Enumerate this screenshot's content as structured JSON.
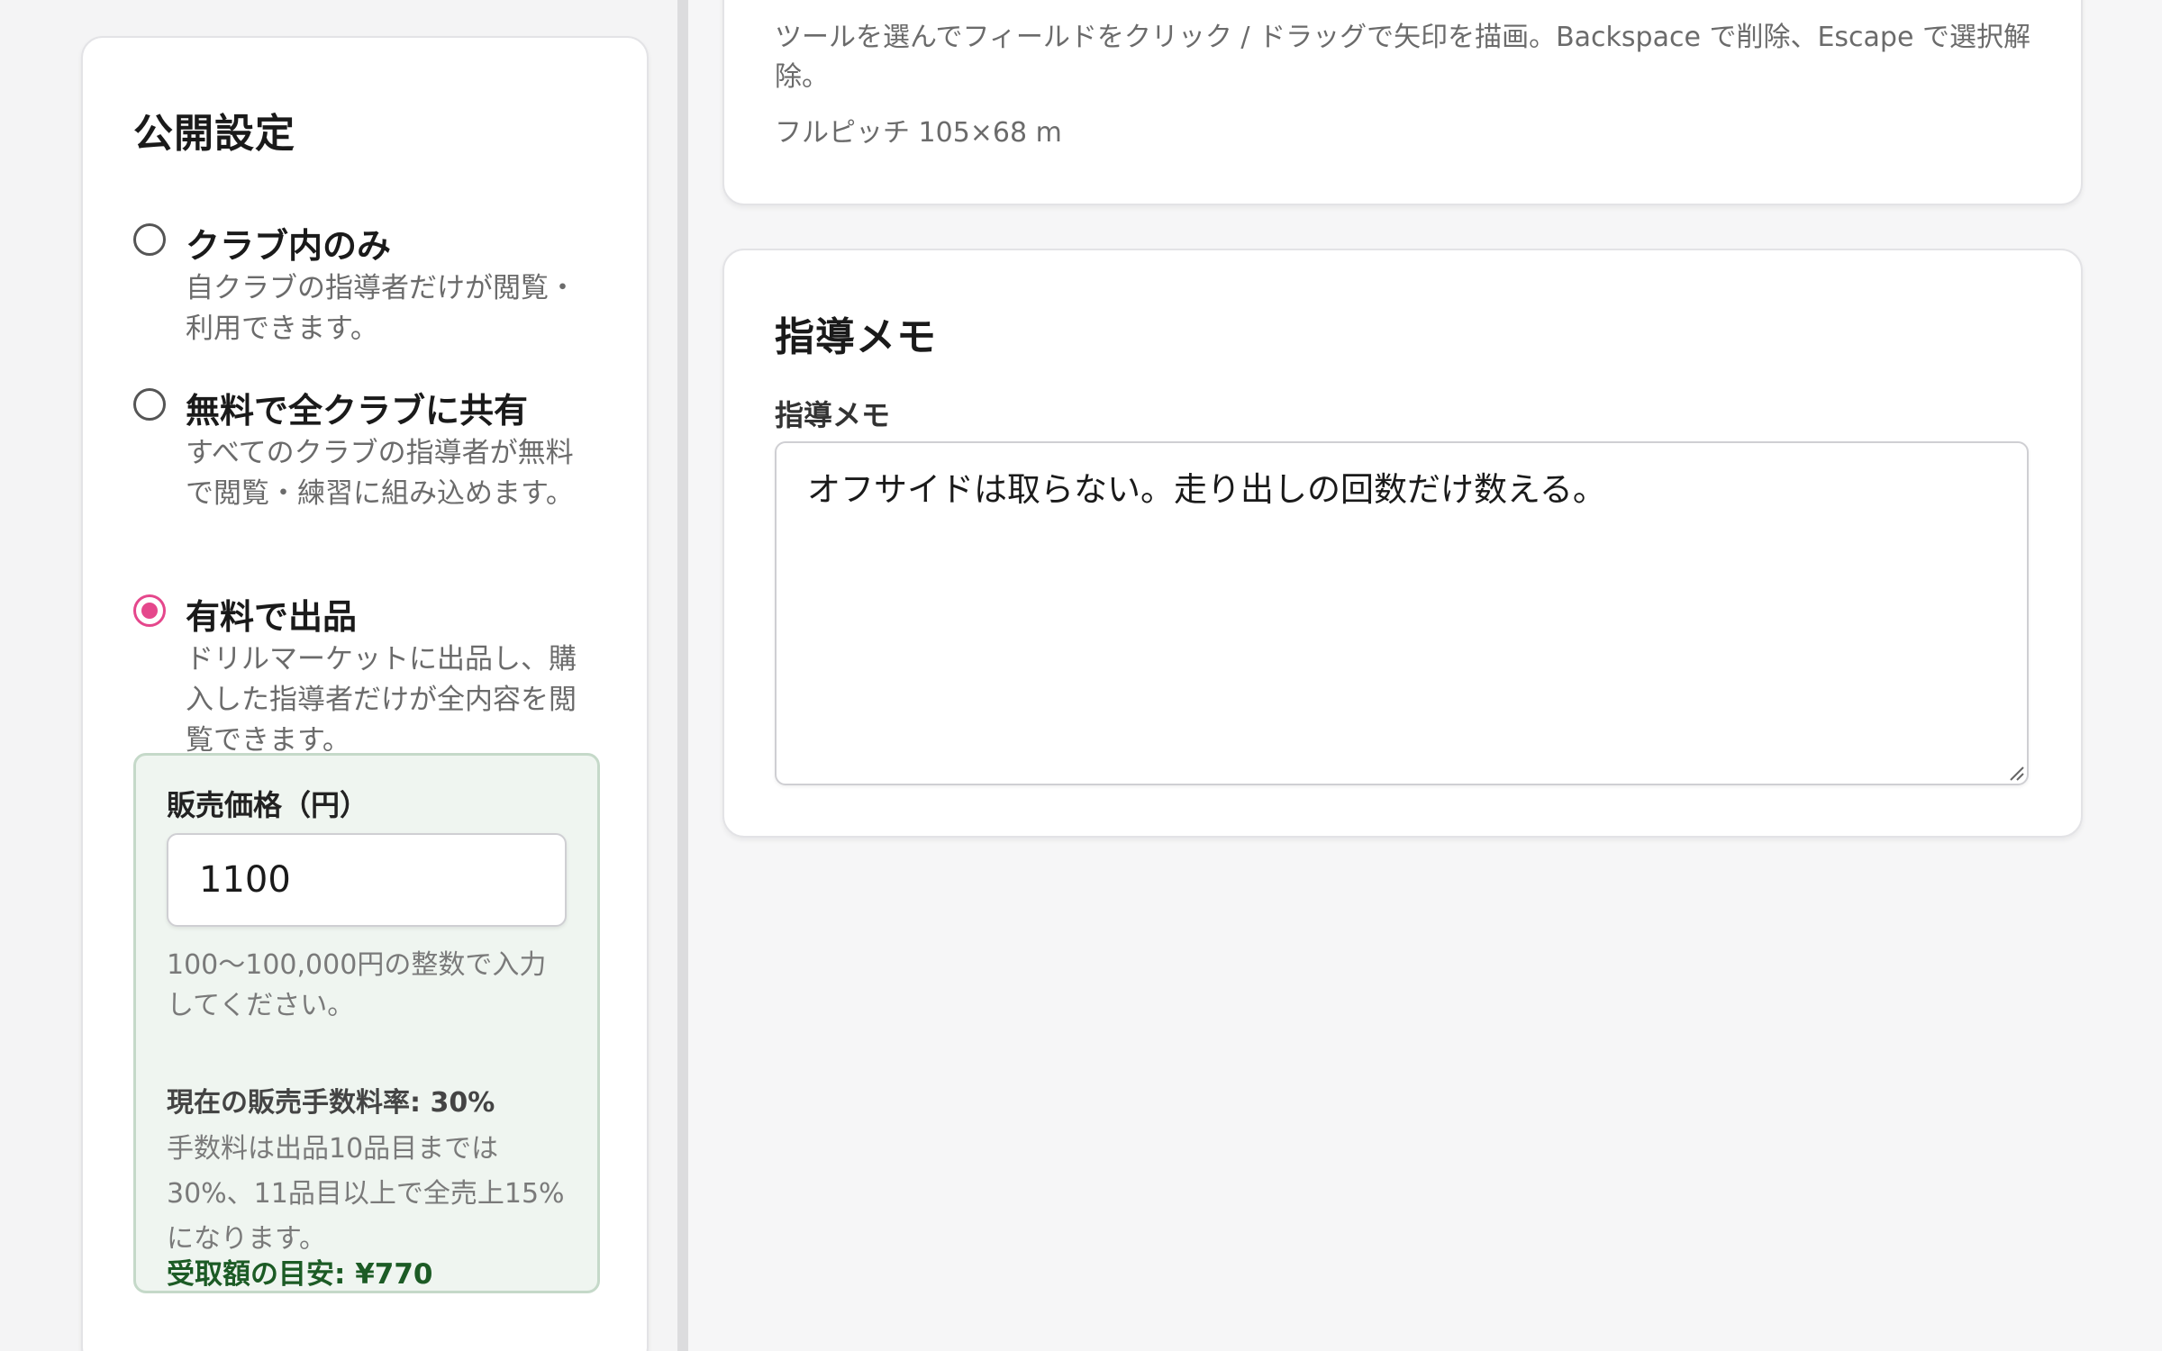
{
  "visibility": {
    "title": "公開設定",
    "options": [
      {
        "label": "クラブ内のみ",
        "description": "自クラブの指導者だけが閲覧・利用できます。",
        "checked": false
      },
      {
        "label": "無料で全クラブに共有",
        "description": "すべてのクラブの指導者が無料で閲覧・練習に組み込めます。",
        "checked": false
      },
      {
        "label": "有料で出品",
        "description": "ドリルマーケットに出品し、購入した指導者だけが全内容を閲覧できます。",
        "checked": true
      }
    ],
    "price": {
      "label": "販売価格（円）",
      "value": "1100",
      "help": "100〜100,000円の整数で入力してください。",
      "fee_rate": "現在の販売手数料率: 30%",
      "fee_note": "手数料は出品10品目までは30%、11品目以上で全売上15%になります。",
      "payout": "受取額の目安: ¥770"
    }
  },
  "tools": {
    "description": "ツールを選んでフィールドをクリック / ドラッグで矢印を描画。Backspace で削除、Escape で選択解除。",
    "pitch_size": "フルピッチ 105×68 m"
  },
  "memo": {
    "title": "指導メモ",
    "label": "指導メモ",
    "value": "オフサイドは取らない。走り出しの回数だけ数える。"
  },
  "colors": {
    "accent": "#e5478c",
    "price_box_bg": "#eff5f0",
    "payout": "#1c5b25"
  }
}
